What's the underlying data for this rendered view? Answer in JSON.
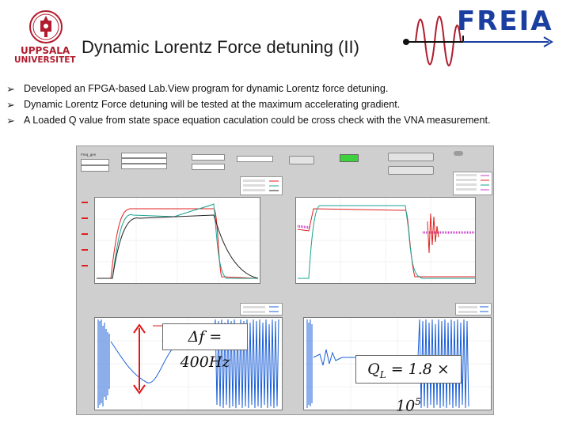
{
  "header": {
    "university": "UPPSALA UNIVERSITET",
    "university_line1": "UPPSALA",
    "university_line2": "UNIVERSITET",
    "title": "Dynamic Lorentz Force detuning (II)",
    "freia_logo": "FREIA"
  },
  "bullets": [
    {
      "icon": "arrow-bullet-icon",
      "text": "Developed an FPGA-based Lab.View program for dynamic Lorentz force detuning."
    },
    {
      "icon": "arrow-bullet-icon",
      "text": "Dynamic Lorentz Force detuning  will be tested at the maximum accelerating gradient."
    },
    {
      "icon": "arrow-bullet-icon",
      "text": "A  Loaded  Q  value  from  state  space  equation  caculation  could  be  cross  check  with  the  VNA measurement."
    }
  ],
  "annotations": {
    "delta_f": "Δf = 400Hz",
    "q_loaded": "Q_L = 1.8 × 10⁵",
    "q_loaded_parts": {
      "base": "Q",
      "sub": "L",
      "rest": " = 1.8 × 10",
      "sup": "5"
    }
  },
  "colors": {
    "title_text": "#1a1a1a",
    "logo_red": "#b01c2e",
    "freia_blue": "#1a3fa0",
    "trace_red": "#e02020",
    "trace_teal": "#1aa391",
    "trace_black": "#222222",
    "trace_blue": "#1a5fd8",
    "trace_magenta": "#c83cc8",
    "arrow_red": "#e01818",
    "indicator_green": "#3dd23d"
  }
}
